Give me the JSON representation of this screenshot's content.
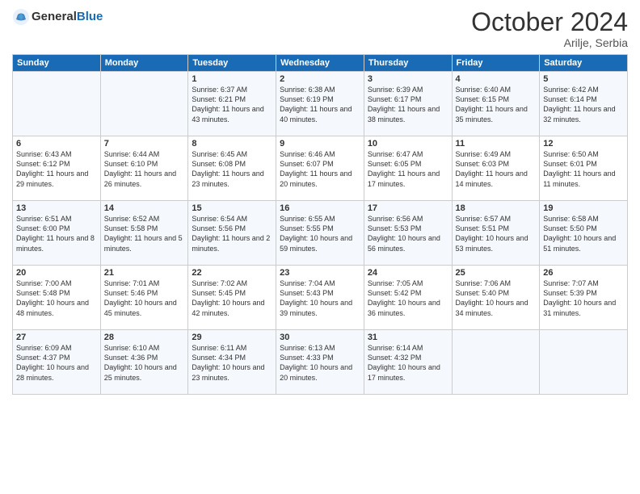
{
  "header": {
    "logo_general": "General",
    "logo_blue": "Blue",
    "month_title": "October 2024",
    "location": "Arilje, Serbia"
  },
  "days_of_week": [
    "Sunday",
    "Monday",
    "Tuesday",
    "Wednesday",
    "Thursday",
    "Friday",
    "Saturday"
  ],
  "weeks": [
    [
      {
        "day": "",
        "sunrise": "",
        "sunset": "",
        "daylight": ""
      },
      {
        "day": "",
        "sunrise": "",
        "sunset": "",
        "daylight": ""
      },
      {
        "day": "1",
        "sunrise": "Sunrise: 6:37 AM",
        "sunset": "Sunset: 6:21 PM",
        "daylight": "Daylight: 11 hours and 43 minutes."
      },
      {
        "day": "2",
        "sunrise": "Sunrise: 6:38 AM",
        "sunset": "Sunset: 6:19 PM",
        "daylight": "Daylight: 11 hours and 40 minutes."
      },
      {
        "day": "3",
        "sunrise": "Sunrise: 6:39 AM",
        "sunset": "Sunset: 6:17 PM",
        "daylight": "Daylight: 11 hours and 38 minutes."
      },
      {
        "day": "4",
        "sunrise": "Sunrise: 6:40 AM",
        "sunset": "Sunset: 6:15 PM",
        "daylight": "Daylight: 11 hours and 35 minutes."
      },
      {
        "day": "5",
        "sunrise": "Sunrise: 6:42 AM",
        "sunset": "Sunset: 6:14 PM",
        "daylight": "Daylight: 11 hours and 32 minutes."
      }
    ],
    [
      {
        "day": "6",
        "sunrise": "Sunrise: 6:43 AM",
        "sunset": "Sunset: 6:12 PM",
        "daylight": "Daylight: 11 hours and 29 minutes."
      },
      {
        "day": "7",
        "sunrise": "Sunrise: 6:44 AM",
        "sunset": "Sunset: 6:10 PM",
        "daylight": "Daylight: 11 hours and 26 minutes."
      },
      {
        "day": "8",
        "sunrise": "Sunrise: 6:45 AM",
        "sunset": "Sunset: 6:08 PM",
        "daylight": "Daylight: 11 hours and 23 minutes."
      },
      {
        "day": "9",
        "sunrise": "Sunrise: 6:46 AM",
        "sunset": "Sunset: 6:07 PM",
        "daylight": "Daylight: 11 hours and 20 minutes."
      },
      {
        "day": "10",
        "sunrise": "Sunrise: 6:47 AM",
        "sunset": "Sunset: 6:05 PM",
        "daylight": "Daylight: 11 hours and 17 minutes."
      },
      {
        "day": "11",
        "sunrise": "Sunrise: 6:49 AM",
        "sunset": "Sunset: 6:03 PM",
        "daylight": "Daylight: 11 hours and 14 minutes."
      },
      {
        "day": "12",
        "sunrise": "Sunrise: 6:50 AM",
        "sunset": "Sunset: 6:01 PM",
        "daylight": "Daylight: 11 hours and 11 minutes."
      }
    ],
    [
      {
        "day": "13",
        "sunrise": "Sunrise: 6:51 AM",
        "sunset": "Sunset: 6:00 PM",
        "daylight": "Daylight: 11 hours and 8 minutes."
      },
      {
        "day": "14",
        "sunrise": "Sunrise: 6:52 AM",
        "sunset": "Sunset: 5:58 PM",
        "daylight": "Daylight: 11 hours and 5 minutes."
      },
      {
        "day": "15",
        "sunrise": "Sunrise: 6:54 AM",
        "sunset": "Sunset: 5:56 PM",
        "daylight": "Daylight: 11 hours and 2 minutes."
      },
      {
        "day": "16",
        "sunrise": "Sunrise: 6:55 AM",
        "sunset": "Sunset: 5:55 PM",
        "daylight": "Daylight: 10 hours and 59 minutes."
      },
      {
        "day": "17",
        "sunrise": "Sunrise: 6:56 AM",
        "sunset": "Sunset: 5:53 PM",
        "daylight": "Daylight: 10 hours and 56 minutes."
      },
      {
        "day": "18",
        "sunrise": "Sunrise: 6:57 AM",
        "sunset": "Sunset: 5:51 PM",
        "daylight": "Daylight: 10 hours and 53 minutes."
      },
      {
        "day": "19",
        "sunrise": "Sunrise: 6:58 AM",
        "sunset": "Sunset: 5:50 PM",
        "daylight": "Daylight: 10 hours and 51 minutes."
      }
    ],
    [
      {
        "day": "20",
        "sunrise": "Sunrise: 7:00 AM",
        "sunset": "Sunset: 5:48 PM",
        "daylight": "Daylight: 10 hours and 48 minutes."
      },
      {
        "day": "21",
        "sunrise": "Sunrise: 7:01 AM",
        "sunset": "Sunset: 5:46 PM",
        "daylight": "Daylight: 10 hours and 45 minutes."
      },
      {
        "day": "22",
        "sunrise": "Sunrise: 7:02 AM",
        "sunset": "Sunset: 5:45 PM",
        "daylight": "Daylight: 10 hours and 42 minutes."
      },
      {
        "day": "23",
        "sunrise": "Sunrise: 7:04 AM",
        "sunset": "Sunset: 5:43 PM",
        "daylight": "Daylight: 10 hours and 39 minutes."
      },
      {
        "day": "24",
        "sunrise": "Sunrise: 7:05 AM",
        "sunset": "Sunset: 5:42 PM",
        "daylight": "Daylight: 10 hours and 36 minutes."
      },
      {
        "day": "25",
        "sunrise": "Sunrise: 7:06 AM",
        "sunset": "Sunset: 5:40 PM",
        "daylight": "Daylight: 10 hours and 34 minutes."
      },
      {
        "day": "26",
        "sunrise": "Sunrise: 7:07 AM",
        "sunset": "Sunset: 5:39 PM",
        "daylight": "Daylight: 10 hours and 31 minutes."
      }
    ],
    [
      {
        "day": "27",
        "sunrise": "Sunrise: 6:09 AM",
        "sunset": "Sunset: 4:37 PM",
        "daylight": "Daylight: 10 hours and 28 minutes."
      },
      {
        "day": "28",
        "sunrise": "Sunrise: 6:10 AM",
        "sunset": "Sunset: 4:36 PM",
        "daylight": "Daylight: 10 hours and 25 minutes."
      },
      {
        "day": "29",
        "sunrise": "Sunrise: 6:11 AM",
        "sunset": "Sunset: 4:34 PM",
        "daylight": "Daylight: 10 hours and 23 minutes."
      },
      {
        "day": "30",
        "sunrise": "Sunrise: 6:13 AM",
        "sunset": "Sunset: 4:33 PM",
        "daylight": "Daylight: 10 hours and 20 minutes."
      },
      {
        "day": "31",
        "sunrise": "Sunrise: 6:14 AM",
        "sunset": "Sunset: 4:32 PM",
        "daylight": "Daylight: 10 hours and 17 minutes."
      },
      {
        "day": "",
        "sunrise": "",
        "sunset": "",
        "daylight": ""
      },
      {
        "day": "",
        "sunrise": "",
        "sunset": "",
        "daylight": ""
      }
    ]
  ]
}
